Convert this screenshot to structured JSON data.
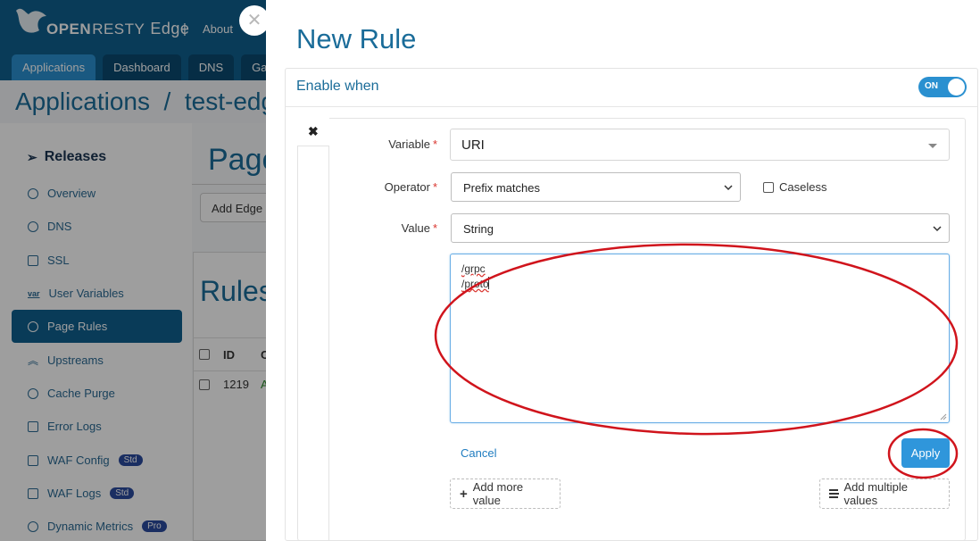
{
  "app": {
    "brand_open": "OPEN",
    "brand_resty": "RESTY",
    "brand_edge": "Edge",
    "nav_separator": "|",
    "nav_about": "About",
    "tabs": [
      {
        "label": "Applications"
      },
      {
        "label": "Dashboard"
      },
      {
        "label": "DNS"
      },
      {
        "label": "Gat"
      }
    ],
    "breadcrumb": "Applications  /  test-edge",
    "page_title": "Page",
    "add_edge_button": "Add Edge L",
    "rules_title": "Rules",
    "table": {
      "col_id": "ID",
      "col_c": "C",
      "row_id": "1219",
      "row_a": "A"
    },
    "sidebar": {
      "releases": "Releases",
      "items": [
        {
          "label": "Overview"
        },
        {
          "label": "DNS"
        },
        {
          "label": "SSL"
        },
        {
          "label": "User Variables",
          "icon_text": "var"
        },
        {
          "label": "Page Rules"
        },
        {
          "label": "Upstreams"
        },
        {
          "label": "Cache Purge"
        },
        {
          "label": "Error Logs"
        },
        {
          "label": "WAF Config",
          "badge": "Std"
        },
        {
          "label": "WAF Logs",
          "badge": "Std"
        },
        {
          "label": "Dynamic Metrics",
          "badge": "Pro"
        }
      ]
    }
  },
  "modal": {
    "close_glyph": "✕",
    "title": "New Rule",
    "section_title": "Enable when",
    "toggle_label": "ON",
    "remove_glyph": "✖",
    "variable": {
      "label": "Variable",
      "required": "*",
      "value": "URI"
    },
    "operator": {
      "label": "Operator",
      "required": "*",
      "value": "Prefix matches"
    },
    "caseless_label": "Caseless",
    "value": {
      "label": "Value",
      "required": "*",
      "type": "String"
    },
    "value_lines": [
      "/grpc",
      "/proto"
    ],
    "cancel_label": "Cancel",
    "apply_label": "Apply",
    "add_more_label": "Add more value",
    "add_multiple_label": "Add multiple values"
  },
  "colors": {
    "brand_blue": "#0f5f8f",
    "accent": "#2f96db",
    "annotation_red": "#d0141c"
  }
}
